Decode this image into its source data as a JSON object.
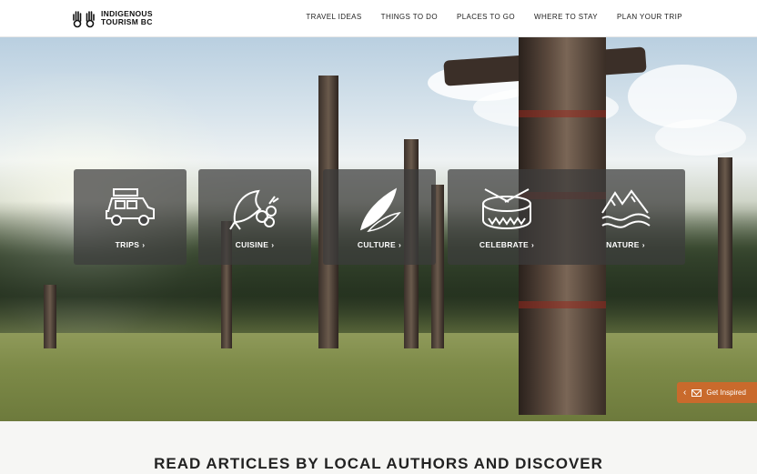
{
  "header": {
    "logo_line1": "INDIGENOUS",
    "logo_line2": "TOURISM BC",
    "nav": [
      "TRAVEL IDEAS",
      "THINGS TO DO",
      "PLACES TO GO",
      "WHERE TO STAY",
      "PLAN YOUR TRIP"
    ]
  },
  "tiles": [
    {
      "label": "TRIPS",
      "icon": "vehicle-icon"
    },
    {
      "label": "CUISINE",
      "icon": "salmon-berries-icon"
    },
    {
      "label": "CULTURE",
      "icon": "feathers-icon"
    },
    {
      "label": "CELEBRATE",
      "icon": "drum-icon"
    },
    {
      "label": "NATURE",
      "icon": "mountains-waves-icon"
    }
  ],
  "chevron": "›",
  "get_inspired": {
    "label": "Get Inspired",
    "chevron": "‹"
  },
  "section": {
    "heading": "READ ARTICLES BY LOCAL AUTHORS AND DISCOVER"
  },
  "colors": {
    "accent": "#c96a2c",
    "tile_bg": "rgba(60,60,60,0.72)"
  }
}
